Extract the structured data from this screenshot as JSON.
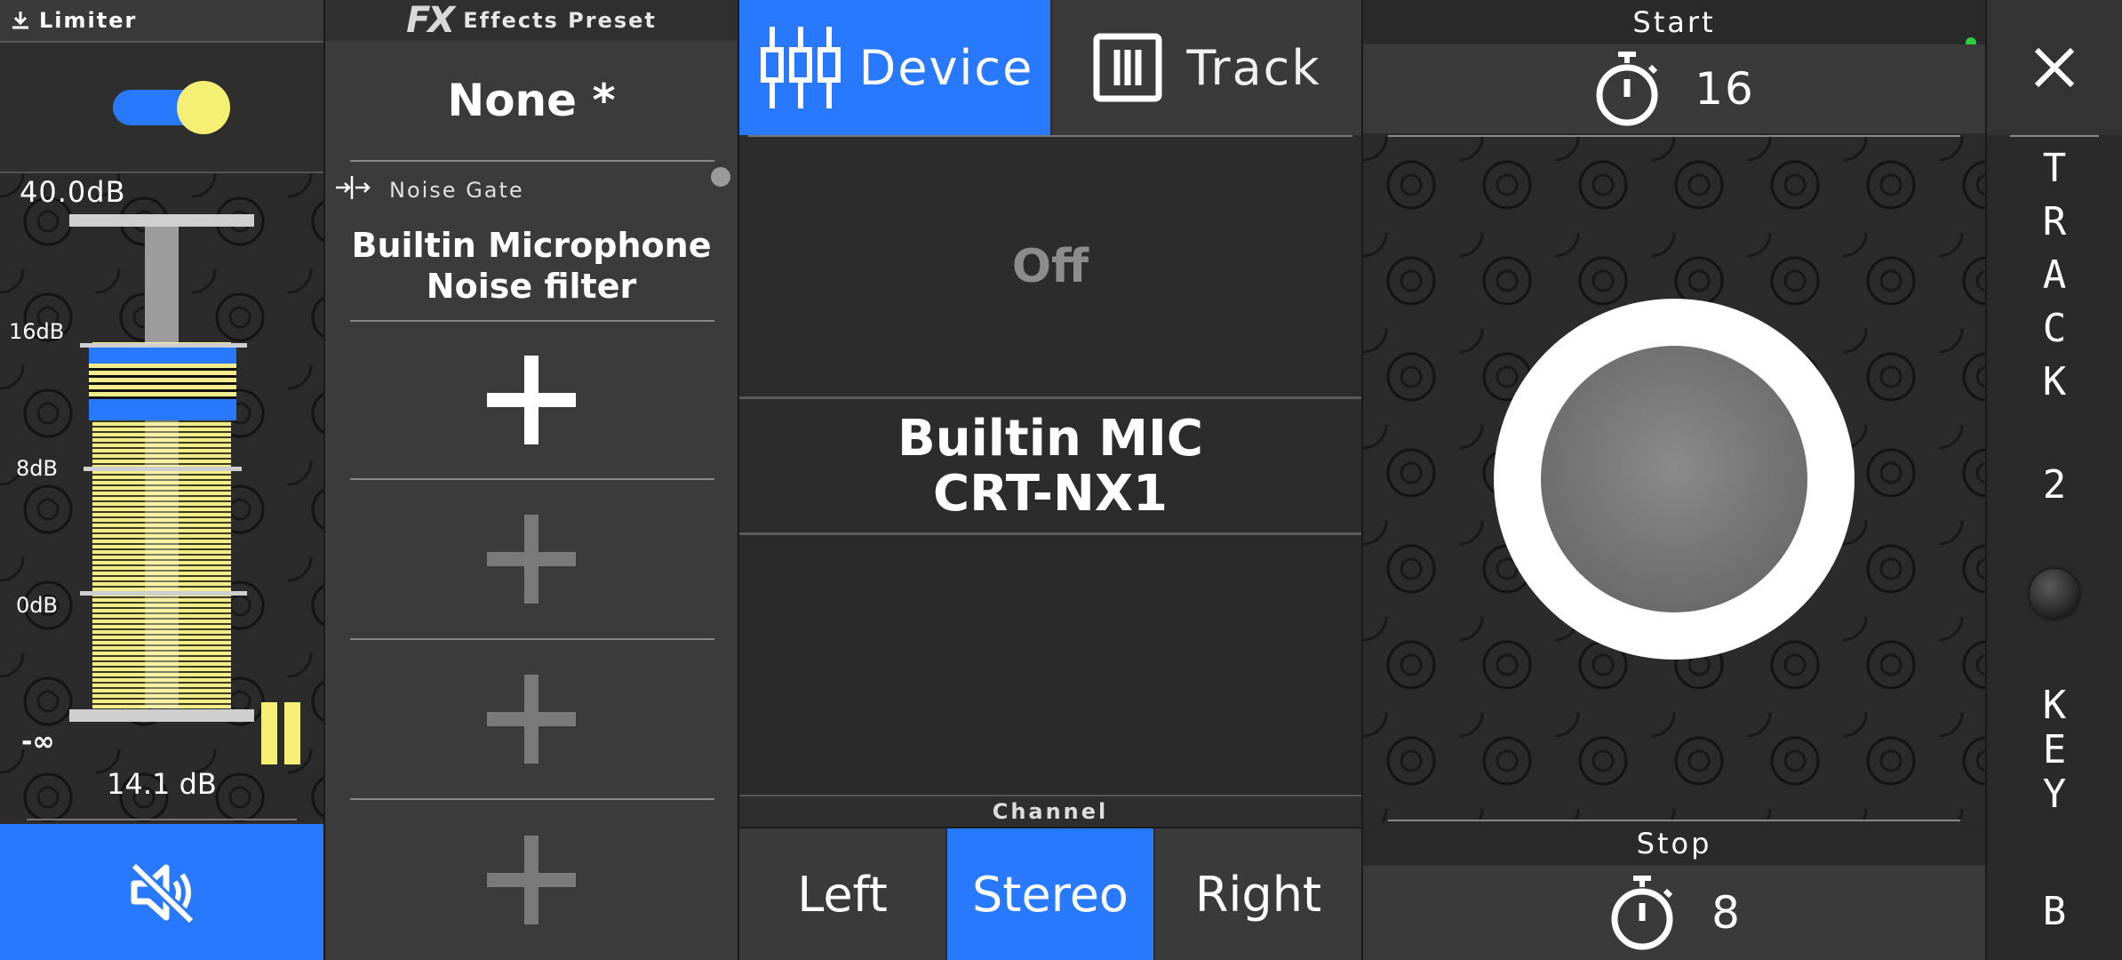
{
  "limiter": {
    "title": "Limiter",
    "enabled": true,
    "max_label": "40.0dB",
    "scale": [
      "16dB",
      "8dB",
      "0dB",
      "-∞"
    ],
    "level_label": "14.1 dB",
    "mute_icon": "speaker-muted-icon",
    "colors": {
      "accent": "#2979ff",
      "meter": "#f3ec8c",
      "toggle_knob": "#f5ef74"
    }
  },
  "effects": {
    "logo": "FX",
    "title": "Effects Preset",
    "preset_name": "None *",
    "slot1": {
      "type_label": "Noise Gate",
      "name_line1": "Builtin Microphone",
      "name_line2": "Noise filter"
    },
    "add_icon": "plus-icon"
  },
  "device": {
    "tabs": [
      {
        "label": "Device",
        "icon": "sliders-icon",
        "active": true
      },
      {
        "label": "Track",
        "icon": "columns-icon",
        "active": false
      }
    ],
    "status": "Off",
    "device_name_line1": "Builtin MIC",
    "device_name_line2": "CRT-NX1",
    "channel_label": "Channel",
    "channels": [
      {
        "label": "Left",
        "active": false
      },
      {
        "label": "Stereo",
        "active": true
      },
      {
        "label": "Right",
        "active": false
      }
    ]
  },
  "recorder": {
    "start_label": "Start",
    "start_value": "16",
    "stop_label": "Stop",
    "stop_value": "8",
    "timer_icon": "stopwatch-icon"
  },
  "side": {
    "close_icon": "close-icon",
    "track_letters": [
      "T",
      "R",
      "A",
      "C",
      "K"
    ],
    "track_number": "2",
    "key_letters": [
      "K",
      "E",
      "Y"
    ],
    "key_value": "B"
  }
}
